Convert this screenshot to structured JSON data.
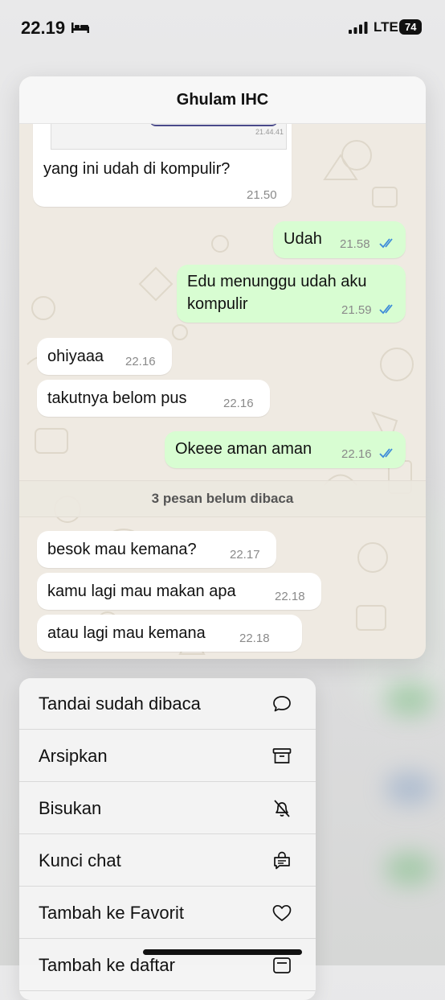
{
  "status_bar": {
    "time": "22.19",
    "network": "LTE",
    "battery": "74"
  },
  "chat_preview": {
    "contact_name": "Ghulam IHC",
    "quoted_image_time": "21.44.41",
    "messages": [
      {
        "dir": "in",
        "text": "yang ini udah di kompulir?",
        "time": "21.50"
      },
      {
        "dir": "out",
        "text": "Udah",
        "time": "21.58"
      },
      {
        "dir": "out",
        "text_line1": "Edu menunggu udah aku",
        "text_line2": "kompulir",
        "time": "21.59"
      },
      {
        "dir": "in",
        "text": "ohiyaaa",
        "time": "22.16"
      },
      {
        "dir": "in",
        "text": "takutnya belom pus",
        "time": "22.16"
      },
      {
        "dir": "out",
        "text": "Okeee aman aman",
        "time": "22.16"
      },
      {
        "dir": "in",
        "text": "besok mau kemana?",
        "time": "22.17"
      },
      {
        "dir": "in",
        "text": "kamu lagi mau makan apa",
        "time": "22.18"
      },
      {
        "dir": "in",
        "text": "atau lagi mau kemana",
        "time": "22.18"
      }
    ],
    "unread_divider": "3 pesan belum dibaca"
  },
  "context_menu": {
    "items": [
      {
        "label": "Tandai sudah dibaca",
        "icon": "chat-bubble-icon"
      },
      {
        "label": "Arsipkan",
        "icon": "archive-icon"
      },
      {
        "label": "Bisukan",
        "icon": "bell-slash-icon"
      },
      {
        "label": "Kunci chat",
        "icon": "lock-chat-icon"
      },
      {
        "label": "Tambah ke Favorit",
        "icon": "heart-icon"
      },
      {
        "label": "Tambah ke daftar",
        "icon": "list-add-icon"
      }
    ]
  },
  "colors": {
    "incoming": "#ffffff",
    "outgoing": "#d8fdd2",
    "read_tick": "#3d8bd9",
    "chat_bg": "#efeae2"
  }
}
